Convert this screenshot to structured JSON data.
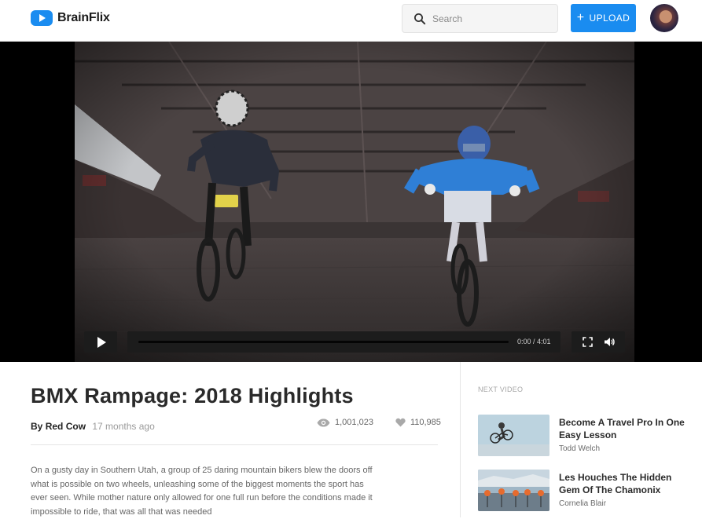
{
  "header": {
    "brand": "BrainFlix",
    "search_placeholder": "Search",
    "upload_label": "UPLOAD"
  },
  "player": {
    "time": "0:00 / 4:01",
    "progress_fraction": 0.0
  },
  "video": {
    "title": "BMX Rampage: 2018 Highlights",
    "by_prefix": "By",
    "channel": "Red Cow",
    "posted": "17 months ago",
    "views": "1,001,023",
    "likes": "110,985",
    "description": "On a gusty day in Southern Utah, a group of 25 daring mountain bikers blew the doors off what is possible on two wheels, unleashing some of the biggest moments the sport has ever seen. While mother nature only allowed for one full run before the conditions made it impossible to ride, that was all that was needed"
  },
  "sidebar": {
    "next_label": "NEXT VIDEO",
    "items": [
      {
        "title": "Become A Travel Pro In One Easy Lesson",
        "author": "Todd Welch"
      },
      {
        "title": "Les Houches The Hidden Gem Of The Chamonix",
        "author": "Cornelia Blair"
      }
    ]
  },
  "colors": {
    "accent": "#1a8cf0",
    "player_bg": "#000000",
    "control_bg": "#1c1c1c"
  },
  "icons": [
    "logo-play-icon",
    "search-icon",
    "plus-icon",
    "play-icon",
    "fullscreen-icon",
    "volume-icon",
    "eye-icon",
    "heart-icon"
  ]
}
